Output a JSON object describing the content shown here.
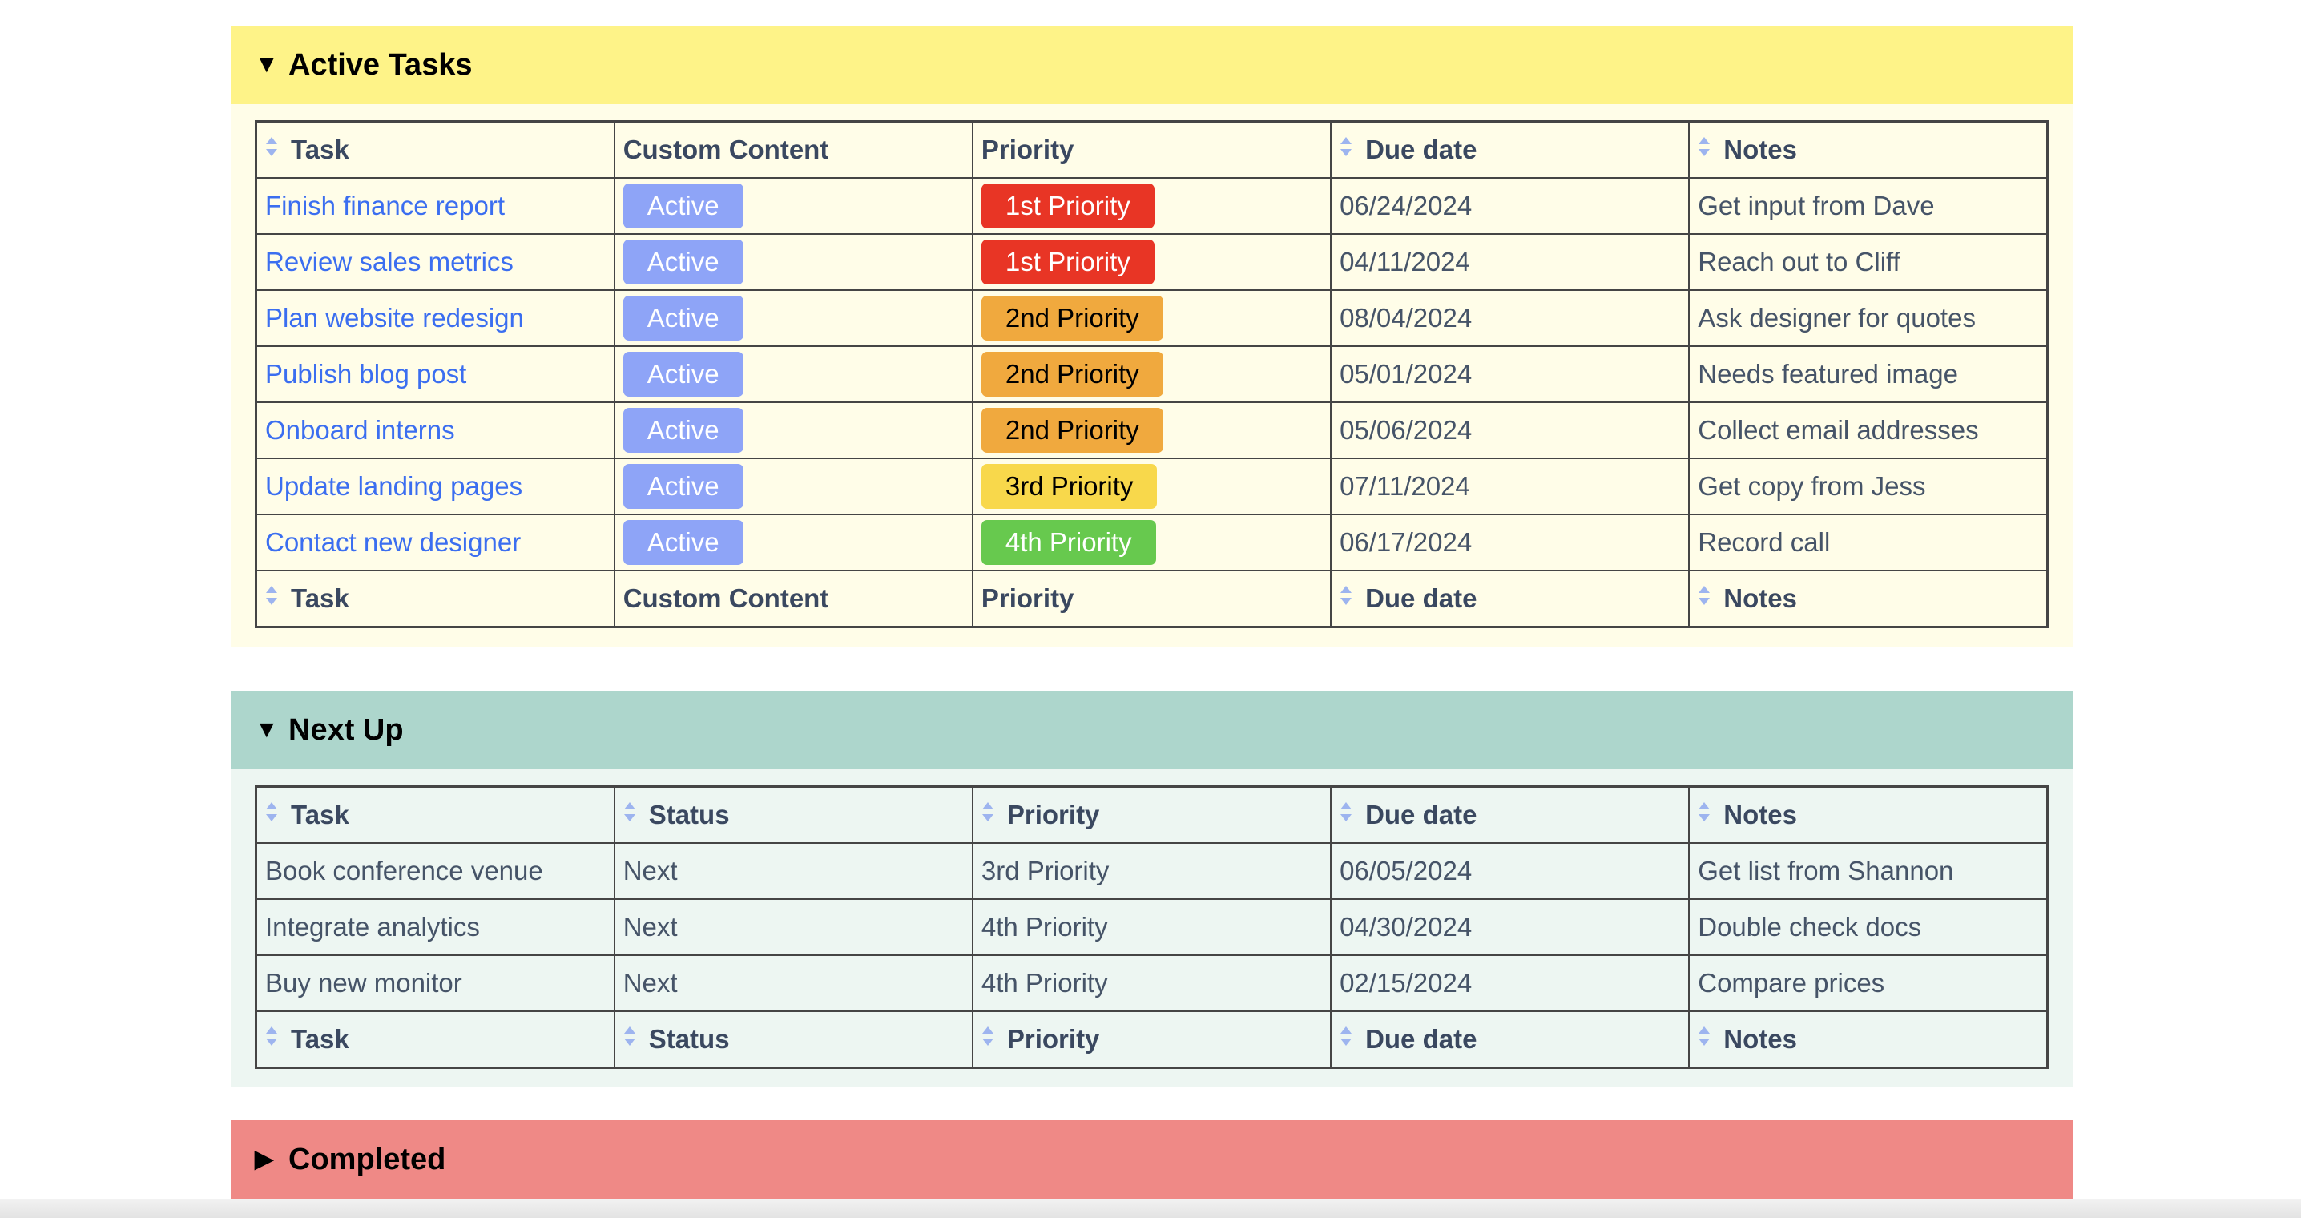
{
  "colors": {
    "active_header": "#fef388",
    "active_body": "#fffde8",
    "next_header": "#add6cc",
    "next_body": "#edf6f2",
    "completed_header": "#ef8986",
    "link": "#3b6ef0",
    "status_active_badge": "#8ea4f7",
    "priority_1": "#e83525",
    "priority_2": "#f0a93e",
    "priority_3": "#f8d84b",
    "priority_4": "#67c94e"
  },
  "sections": {
    "active": {
      "title": "Active Tasks",
      "expanded": true,
      "caret_icon": "triangle-down-icon",
      "columns": [
        {
          "label": "Task",
          "sortable": true
        },
        {
          "label": "Custom Content",
          "sortable": false
        },
        {
          "label": "Priority",
          "sortable": false
        },
        {
          "label": "Due date",
          "sortable": true
        },
        {
          "label": "Notes",
          "sortable": true
        }
      ],
      "rows": [
        {
          "task": "Finish finance report",
          "status": "Active",
          "priority": "1st Priority",
          "priority_level": 1,
          "due": "06/24/2024",
          "notes": "Get input from Dave"
        },
        {
          "task": "Review sales metrics",
          "status": "Active",
          "priority": "1st Priority",
          "priority_level": 1,
          "due": "04/11/2024",
          "notes": "Reach out to Cliff"
        },
        {
          "task": "Plan website redesign",
          "status": "Active",
          "priority": "2nd Priority",
          "priority_level": 2,
          "due": "08/04/2024",
          "notes": "Ask designer for quotes"
        },
        {
          "task": "Publish blog post",
          "status": "Active",
          "priority": "2nd Priority",
          "priority_level": 2,
          "due": "05/01/2024",
          "notes": "Needs featured image"
        },
        {
          "task": "Onboard interns",
          "status": "Active",
          "priority": "2nd Priority",
          "priority_level": 2,
          "due": "05/06/2024",
          "notes": "Collect email addresses"
        },
        {
          "task": "Update landing pages",
          "status": "Active",
          "priority": "3rd Priority",
          "priority_level": 3,
          "due": "07/11/2024",
          "notes": "Get copy from Jess"
        },
        {
          "task": "Contact new designer",
          "status": "Active",
          "priority": "4th Priority",
          "priority_level": 4,
          "due": "06/17/2024",
          "notes": "Record call"
        }
      ]
    },
    "next": {
      "title": "Next Up",
      "expanded": true,
      "caret_icon": "triangle-down-icon",
      "columns": [
        {
          "label": "Task",
          "sortable": true
        },
        {
          "label": "Status",
          "sortable": true
        },
        {
          "label": "Priority",
          "sortable": true
        },
        {
          "label": "Due date",
          "sortable": true
        },
        {
          "label": "Notes",
          "sortable": true
        }
      ],
      "rows": [
        {
          "task": "Book conference venue",
          "status": "Next",
          "priority": "3rd Priority",
          "due": "06/05/2024",
          "notes": "Get list from Shannon"
        },
        {
          "task": "Integrate analytics",
          "status": "Next",
          "priority": "4th Priority",
          "due": "04/30/2024",
          "notes": "Double check docs"
        },
        {
          "task": "Buy new monitor",
          "status": "Next",
          "priority": "4th Priority",
          "due": "02/15/2024",
          "notes": "Compare prices"
        }
      ]
    },
    "completed": {
      "title": "Completed",
      "expanded": false,
      "caret_icon": "triangle-right-icon"
    }
  }
}
